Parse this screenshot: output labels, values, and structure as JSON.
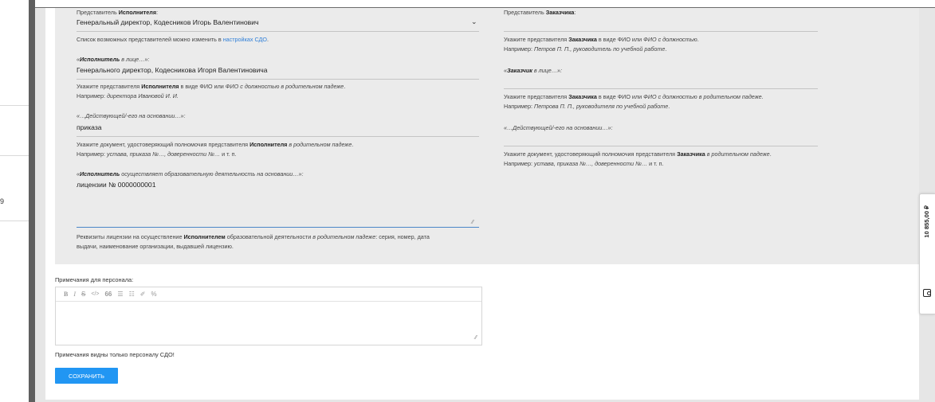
{
  "sidebar": {
    "mark": "9"
  },
  "executor": {
    "rep_label_pre": "Представитель ",
    "rep_label_bold": "Исполнителя",
    "rep_label_post": ":",
    "rep_value": "Генеральный директор, Кодесников Игорь Валентинович",
    "rep_hint_pre": "Список возможных представителей можно изменить в ",
    "rep_hint_link": "настройках СДО",
    "rep_hint_post": ".",
    "face_label_pre": "«",
    "face_label_bold": "Исполнитель",
    "face_label_post": " в лице…»:",
    "face_value": "Генерального директор, Кодесникова Игоря Валентиновича",
    "face_hint1_pre": "Укажите представителя ",
    "face_hint1_bold": "Исполнителя",
    "face_hint1_mid": " в виде ФИО или ",
    "face_hint1_italic": "ФИО с должностью в родительном падеже",
    "face_hint1_post": ".",
    "face_hint2_pre": "Например: ",
    "face_hint2_italic": "директора Ивановой И. И.",
    "basis_label": "«…Действующей/-его на основании…»:",
    "basis_value": "приказа",
    "basis_hint1_pre": "Укажите документ, удостоверяющий полномочия представителя ",
    "basis_hint1_bold": "Исполнителя",
    "basis_hint1_italic": " в родительном падеже",
    "basis_hint1_post": ".",
    "basis_hint2_pre": "Например: ",
    "basis_hint2_italic": "устава, приказа №…, доверенности №…",
    "basis_hint2_post": " и т. п.",
    "activity_label_pre": "«",
    "activity_label_bold": "Исполнитель",
    "activity_label_post": " осуществляет образовательную деятельность на основании…»:",
    "activity_value": "лицензии № 0000000001",
    "activity_hint1_pre": "Реквизиты лицензии на осуществление ",
    "activity_hint1_bold": "Исполнителем",
    "activity_hint1_mid": " образовательной деятельности ",
    "activity_hint1_italic": "в родительном падеже",
    "activity_hint1_post": ": серия, номер, дата",
    "activity_hint2": "выдачи, наименование организации, выдавшей лицензию."
  },
  "customer": {
    "rep_label_pre": "Представитель ",
    "rep_label_bold": "Заказчика",
    "rep_label_post": ":",
    "rep_hint1_pre": "Укажите представителя ",
    "rep_hint1_bold": "Заказчика",
    "rep_hint1_mid": " в виде ФИО или ",
    "rep_hint1_italic": "ФИО с должностью",
    "rep_hint1_post": ".",
    "rep_hint2_pre": "Например: ",
    "rep_hint2_italic": "Петров П. П., руководитель по учебной работе",
    "rep_hint2_post": ".",
    "face_label_pre": "«",
    "face_label_bold": "Заказчик",
    "face_label_post": " в лице…»:",
    "face_hint1_pre": "Укажите представителя ",
    "face_hint1_bold": "Заказчика",
    "face_hint1_mid": " в виде ФИО или ",
    "face_hint1_italic": "ФИО с должностью в родительном падеже",
    "face_hint1_post": ".",
    "face_hint2_pre": "Например: ",
    "face_hint2_italic": "Петрова П. П., руководителя по учебной работе",
    "face_hint2_post": ".",
    "basis_label": "«…Действующей/-его на основании…»:",
    "basis_hint1_pre": "Укажите документ, удостоверяющий полномочия представителя ",
    "basis_hint1_bold": "Заказчика",
    "basis_hint1_italic": " в родительном падеже",
    "basis_hint1_post": ".",
    "basis_hint2_pre": "Например: ",
    "basis_hint2_italic": "устава, приказа №…, доверенности №…",
    "basis_hint2_post": " и т. п."
  },
  "notes": {
    "label": "Примечания для персонала:",
    "hint": "Примечания видны только персоналу СДО!",
    "toolbar": [
      "B",
      "I",
      "S",
      "</>",
      "66",
      "☰",
      "☷",
      "✐",
      "%"
    ]
  },
  "actions": {
    "save_label": "СОХРАНИТЬ"
  },
  "side": {
    "price": "10 855,00 ₽"
  }
}
